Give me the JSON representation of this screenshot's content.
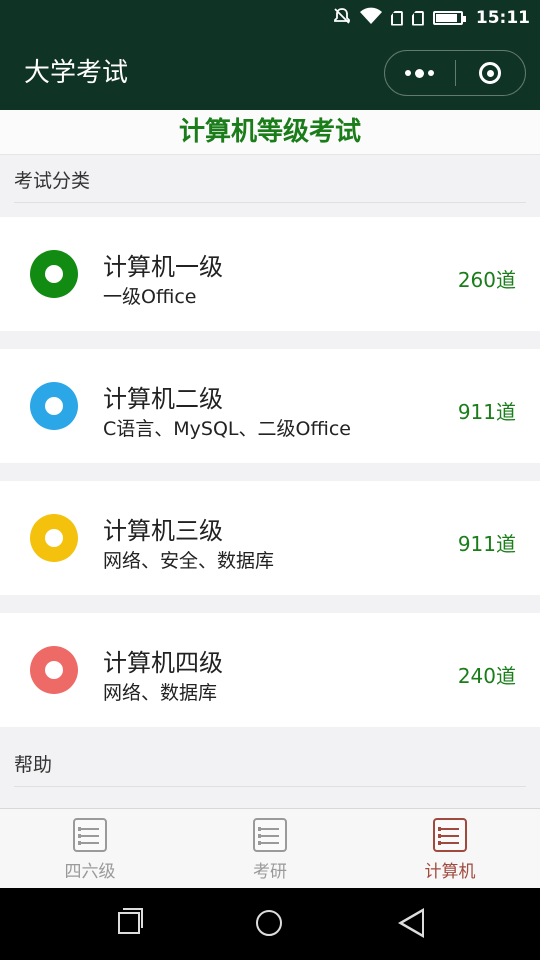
{
  "status_bar": {
    "time": "15:11",
    "icons": [
      "bell-off-icon",
      "wifi-icon",
      "sim-icon",
      "sim-icon",
      "battery-icon"
    ]
  },
  "nav": {
    "title": "大学考试",
    "more_icon": "more-dots-icon",
    "close_icon": "close-miniprogram-icon"
  },
  "banner": "计算机等级考试",
  "sections": {
    "category_label": "考试分类",
    "help_label": "帮助"
  },
  "exams": [
    {
      "name": "计算机一级",
      "desc": "一级Office",
      "count": "260道",
      "color": "#118b11"
    },
    {
      "name": "计算机二级",
      "desc": "C语言、MySQL、二级Office",
      "count": "911道",
      "color": "#2ba6e6"
    },
    {
      "name": "计算机三级",
      "desc": "网络、安全、数据库",
      "count": "911道",
      "color": "#f4c20d"
    },
    {
      "name": "计算机四级",
      "desc": "网络、数据库",
      "count": "240道",
      "color": "#ee6a66"
    }
  ],
  "tabs": [
    {
      "label": "四六级",
      "active": false
    },
    {
      "label": "考研",
      "active": false
    },
    {
      "label": "计算机",
      "active": true
    }
  ],
  "colors": {
    "header_bg": "#0f3324",
    "accent_green": "#1a7d1a",
    "active_tab": "#a04a3e",
    "inactive_tab": "#9a9a9a"
  }
}
